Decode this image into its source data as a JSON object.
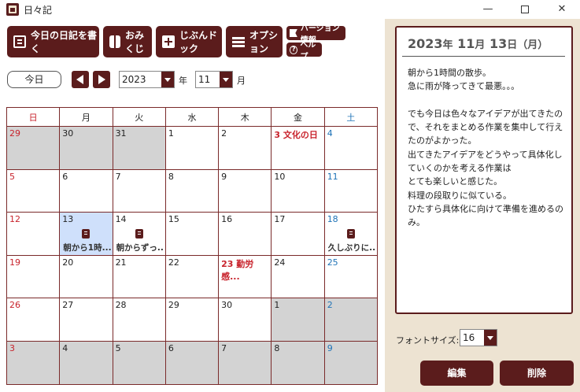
{
  "window": {
    "title": "日々記",
    "minimize": "—",
    "close": "✕"
  },
  "toolbar": {
    "write_today": "今日の日記を書く",
    "omikuji": "おみくじ",
    "dock": "じぶんドック",
    "options": "オプション",
    "version": "バージョン情報",
    "help": "ヘルプ"
  },
  "nav": {
    "today": "今日",
    "year": "2023",
    "year_unit": "年",
    "month": "11",
    "month_unit": "月"
  },
  "calendar": {
    "weekdays": [
      "日",
      "月",
      "火",
      "水",
      "木",
      "金",
      "土"
    ],
    "weeks": [
      [
        {
          "d": "29",
          "o": 1
        },
        {
          "d": "30",
          "o": 1
        },
        {
          "d": "31",
          "o": 1
        },
        {
          "d": "1"
        },
        {
          "d": "2"
        },
        {
          "d": "3 文化の日",
          "h": 1
        },
        {
          "d": "4"
        }
      ],
      [
        {
          "d": "5"
        },
        {
          "d": "6"
        },
        {
          "d": "7"
        },
        {
          "d": "8"
        },
        {
          "d": "9"
        },
        {
          "d": "10"
        },
        {
          "d": "11"
        }
      ],
      [
        {
          "d": "12"
        },
        {
          "d": "13",
          "s": 1,
          "e": "朝から1時..."
        },
        {
          "d": "14",
          "e": "朝からずっ..."
        },
        {
          "d": "15"
        },
        {
          "d": "16"
        },
        {
          "d": "17"
        },
        {
          "d": "18",
          "e": "久しぶりに..."
        }
      ],
      [
        {
          "d": "19"
        },
        {
          "d": "20"
        },
        {
          "d": "21"
        },
        {
          "d": "22"
        },
        {
          "d": "23 勤労感...",
          "h": 1
        },
        {
          "d": "24"
        },
        {
          "d": "25"
        }
      ],
      [
        {
          "d": "26"
        },
        {
          "d": "27"
        },
        {
          "d": "28"
        },
        {
          "d": "29"
        },
        {
          "d": "30"
        },
        {
          "d": "1",
          "o": 1
        },
        {
          "d": "2",
          "o": 1
        }
      ],
      [
        {
          "d": "3",
          "o": 1
        },
        {
          "d": "4",
          "o": 1
        },
        {
          "d": "5",
          "o": 1
        },
        {
          "d": "6",
          "o": 1
        },
        {
          "d": "7",
          "o": 1
        },
        {
          "d": "8",
          "o": 1
        },
        {
          "d": "9",
          "o": 1
        }
      ]
    ]
  },
  "diary": {
    "year": "2023",
    "year_unit": "年",
    "month": "11",
    "month_unit": "月",
    "day": "13",
    "day_unit": "日",
    "weekday": "（月）",
    "body": "朝から1時間の散歩。\n急に雨が降ってきて最悪。。。\n\nでも今日は色々なアイデアが出てきたので、それをまとめる作業を集中して行えたのがよかった。\n出てきたアイデアをどうやって具体化していくのかを考える作業は\nとても楽しいと感じた。\n料理の段取りに似ている。\nひたすら具体化に向けて準備を進めるのみ。"
  },
  "settings": {
    "font_size_label": "フォントサイズ:",
    "font_size": "16"
  },
  "actions": {
    "edit": "編集",
    "delete": "削除"
  },
  "colors": {
    "accent": "#5b1c1c",
    "panel_bg": "#ede3d2",
    "selected": "#cfe0fb",
    "other_month": "#d3d3d3",
    "sunday": "#c8232c",
    "saturday": "#1f73b7"
  }
}
